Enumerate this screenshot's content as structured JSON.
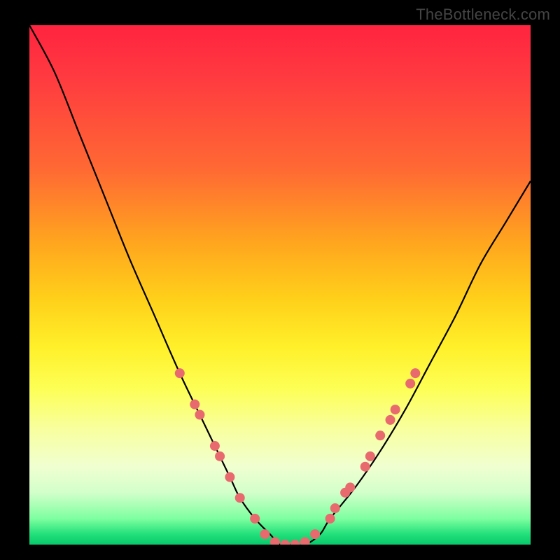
{
  "watermark": "TheBottleneck.com",
  "chart_data": {
    "type": "line",
    "title": "",
    "xlabel": "",
    "ylabel": "",
    "xlim": [
      0,
      100
    ],
    "ylim": [
      0,
      100
    ],
    "series": [
      {
        "name": "curve",
        "x": [
          0,
          5,
          10,
          15,
          20,
          25,
          30,
          35,
          40,
          42,
          45,
          48,
          50,
          52,
          55,
          58,
          60,
          65,
          70,
          75,
          80,
          85,
          90,
          95,
          100
        ],
        "y": [
          100,
          91,
          79,
          67,
          55,
          44,
          33,
          23,
          13,
          9,
          5,
          2,
          0,
          0,
          0,
          2,
          5,
          11,
          18,
          26,
          35,
          44,
          54,
          62,
          70
        ]
      }
    ],
    "markers": [
      {
        "x": 30,
        "y": 33
      },
      {
        "x": 33,
        "y": 27
      },
      {
        "x": 34,
        "y": 25
      },
      {
        "x": 37,
        "y": 19
      },
      {
        "x": 38,
        "y": 17
      },
      {
        "x": 40,
        "y": 13
      },
      {
        "x": 42,
        "y": 9
      },
      {
        "x": 45,
        "y": 5
      },
      {
        "x": 47,
        "y": 2
      },
      {
        "x": 49,
        "y": 0.5
      },
      {
        "x": 51,
        "y": 0
      },
      {
        "x": 53,
        "y": 0
      },
      {
        "x": 55,
        "y": 0.5
      },
      {
        "x": 57,
        "y": 2
      },
      {
        "x": 60,
        "y": 5
      },
      {
        "x": 61,
        "y": 7
      },
      {
        "x": 63,
        "y": 10
      },
      {
        "x": 64,
        "y": 11
      },
      {
        "x": 67,
        "y": 15
      },
      {
        "x": 68,
        "y": 17
      },
      {
        "x": 70,
        "y": 21
      },
      {
        "x": 72,
        "y": 24
      },
      {
        "x": 73,
        "y": 26
      },
      {
        "x": 76,
        "y": 31
      },
      {
        "x": 77,
        "y": 33
      }
    ]
  }
}
